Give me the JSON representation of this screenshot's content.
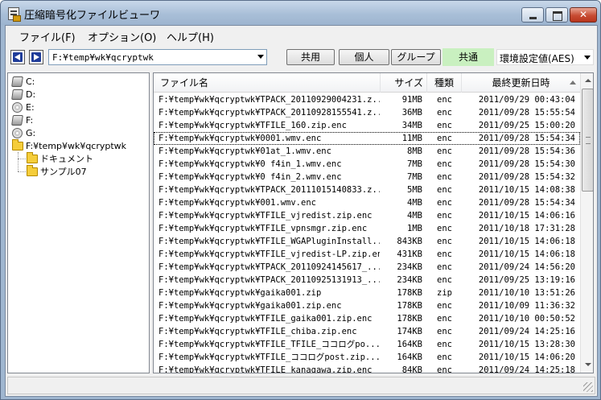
{
  "window": {
    "title": "圧縮暗号化ファイルビューワ"
  },
  "menu": [
    "ファイル(F)",
    "オプション(O)",
    "ヘルプ(H)"
  ],
  "toolbar": {
    "path": "F:¥temp¥wk¥qcryptwk",
    "buttons": [
      "共用",
      "個人",
      "グループ"
    ],
    "active_mode": "共通",
    "encryption": "環境設定値(AES)"
  },
  "tree": {
    "drives": [
      "C:",
      "D:",
      "E:",
      "F:",
      "G:"
    ],
    "root_folder": "F:¥temp¥wk¥qcryptwk",
    "subfolders": [
      "ドキュメント",
      "サンプル07"
    ]
  },
  "columns": [
    "ファイル名",
    "サイズ",
    "種類",
    "最終更新日時"
  ],
  "files": [
    [
      "F:¥temp¥wk¥qcryptwk¥TPACK_20110929004231.z...",
      "91MB",
      "enc",
      "2011/09/29 00:43:04"
    ],
    [
      "F:¥temp¥wk¥qcryptwk¥TPACK_20110928155541.z...",
      "36MB",
      "enc",
      "2011/09/28 15:55:54"
    ],
    [
      "F:¥temp¥wk¥qcryptwk¥TFILE_160.zip.enc",
      "34MB",
      "enc",
      "2011/09/25 15:00:20"
    ],
    [
      "F:¥temp¥wk¥qcryptwk¥0001.wmv.enc",
      "11MB",
      "enc",
      "2011/09/28 15:54:34"
    ],
    [
      "F:¥temp¥wk¥qcryptwk¥01at_1.wmv.enc",
      "8MB",
      "enc",
      "2011/09/28 15:54:36"
    ],
    [
      "F:¥temp¥wk¥qcryptwk¥0 f4in_1.wmv.enc",
      "7MB",
      "enc",
      "2011/09/28 15:54:30"
    ],
    [
      "F:¥temp¥wk¥qcryptwk¥0 f4in_2.wmv.enc",
      "7MB",
      "enc",
      "2011/09/28 15:54:32"
    ],
    [
      "F:¥temp¥wk¥qcryptwk¥TPACK_20111015140833.z...",
      "5MB",
      "enc",
      "2011/10/15 14:08:38"
    ],
    [
      "F:¥temp¥wk¥qcryptwk¥001.wmv.enc",
      "4MB",
      "enc",
      "2011/09/28 15:54:34"
    ],
    [
      "F:¥temp¥wk¥qcryptwk¥TFILE_vjredist.zip.enc",
      "4MB",
      "enc",
      "2011/10/15 14:06:16"
    ],
    [
      "F:¥temp¥wk¥qcryptwk¥TFILE_vpnsmgr.zip.enc",
      "1MB",
      "enc",
      "2011/10/18 17:31:28"
    ],
    [
      "F:¥temp¥wk¥qcryptwk¥TFILE_WGAPluginInstall...",
      "843KB",
      "enc",
      "2011/10/15 14:06:18"
    ],
    [
      "F:¥temp¥wk¥qcryptwk¥TFILE_vjredist-LP.zip.enc",
      "431KB",
      "enc",
      "2011/10/15 14:06:18"
    ],
    [
      "F:¥temp¥wk¥qcryptwk¥TPACK_20110924145617_...",
      "234KB",
      "enc",
      "2011/09/24 14:56:20"
    ],
    [
      "F:¥temp¥wk¥qcryptwk¥TPACK_20110925131913_...",
      "234KB",
      "enc",
      "2011/09/25 13:19:16"
    ],
    [
      "F:¥temp¥wk¥qcryptwk¥gaika001.zip",
      "178KB",
      "zip",
      "2011/10/10 13:51:26"
    ],
    [
      "F:¥temp¥wk¥qcryptwk¥gaika001.zip.enc",
      "178KB",
      "enc",
      "2011/10/09 11:36:32"
    ],
    [
      "F:¥temp¥wk¥qcryptwk¥TFILE_gaika001.zip.enc",
      "178KB",
      "enc",
      "2011/10/10 00:50:52"
    ],
    [
      "F:¥temp¥wk¥qcryptwk¥TFILE_chiba.zip.enc",
      "174KB",
      "enc",
      "2011/09/24 14:25:16"
    ],
    [
      "F:¥temp¥wk¥qcryptwk¥TFILE_TFILE_ココログpo...",
      "164KB",
      "enc",
      "2011/10/15 13:28:30"
    ],
    [
      "F:¥temp¥wk¥qcryptwk¥TFILE_ココログpost.zip...",
      "164KB",
      "enc",
      "2011/10/15 14:06:20"
    ],
    [
      "F:¥temp¥wk¥qcryptwk¥TFILE_kanagawa.zip.enc",
      "84KB",
      "enc",
      "2011/09/24 14:25:18"
    ]
  ]
}
